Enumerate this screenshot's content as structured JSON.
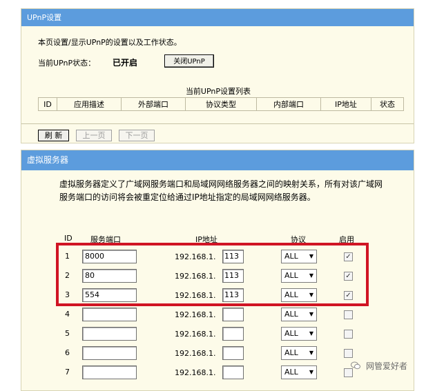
{
  "upnp": {
    "title": "UPnP设置",
    "description": "本页设置/显示UPnP的设置以及工作状态。",
    "status_label": "当前UPnP状态：",
    "status_value": "已开启",
    "toggle_button": "关闭UPnP",
    "list_title": "当前UPnP设置列表",
    "columns": [
      "ID",
      "应用描述",
      "外部端口",
      "协议类型",
      "内部端口",
      "IP地址",
      "状态"
    ],
    "buttons": {
      "refresh": "刷 新",
      "prev": "上一页",
      "next": "下一页"
    }
  },
  "virtual_server": {
    "title": "虚拟服务器",
    "description": "虚拟服务器定义了广域网服务端口和局域网网络服务器之间的映射关系，所有对该广域网服务端口的访问将会被重定位给通过IP地址指定的局域网网络服务器。",
    "columns": {
      "id": "ID",
      "port": "服务端口",
      "ip": "IP地址",
      "protocol": "协议",
      "enabled": "启用"
    },
    "ip_prefix": "192.168.1.",
    "rows": [
      {
        "id": "1",
        "port": "8000",
        "ip_last": "113",
        "protocol": "ALL",
        "enabled": true
      },
      {
        "id": "2",
        "port": "80",
        "ip_last": "113",
        "protocol": "ALL",
        "enabled": true
      },
      {
        "id": "3",
        "port": "554",
        "ip_last": "113",
        "protocol": "ALL",
        "enabled": true
      },
      {
        "id": "4",
        "port": "",
        "ip_last": "",
        "protocol": "ALL",
        "enabled": false
      },
      {
        "id": "5",
        "port": "",
        "ip_last": "",
        "protocol": "ALL",
        "enabled": false
      },
      {
        "id": "6",
        "port": "",
        "ip_last": "",
        "protocol": "ALL",
        "enabled": false
      },
      {
        "id": "7",
        "port": "",
        "ip_last": "",
        "protocol": "ALL",
        "enabled": false
      }
    ]
  },
  "watermark": {
    "text": "网管爱好者",
    "icon": "wechat-icon"
  },
  "colors": {
    "title_bar": "#5c9cdd",
    "panel_bg": "#fdfbe9",
    "highlight": "#d01424"
  }
}
